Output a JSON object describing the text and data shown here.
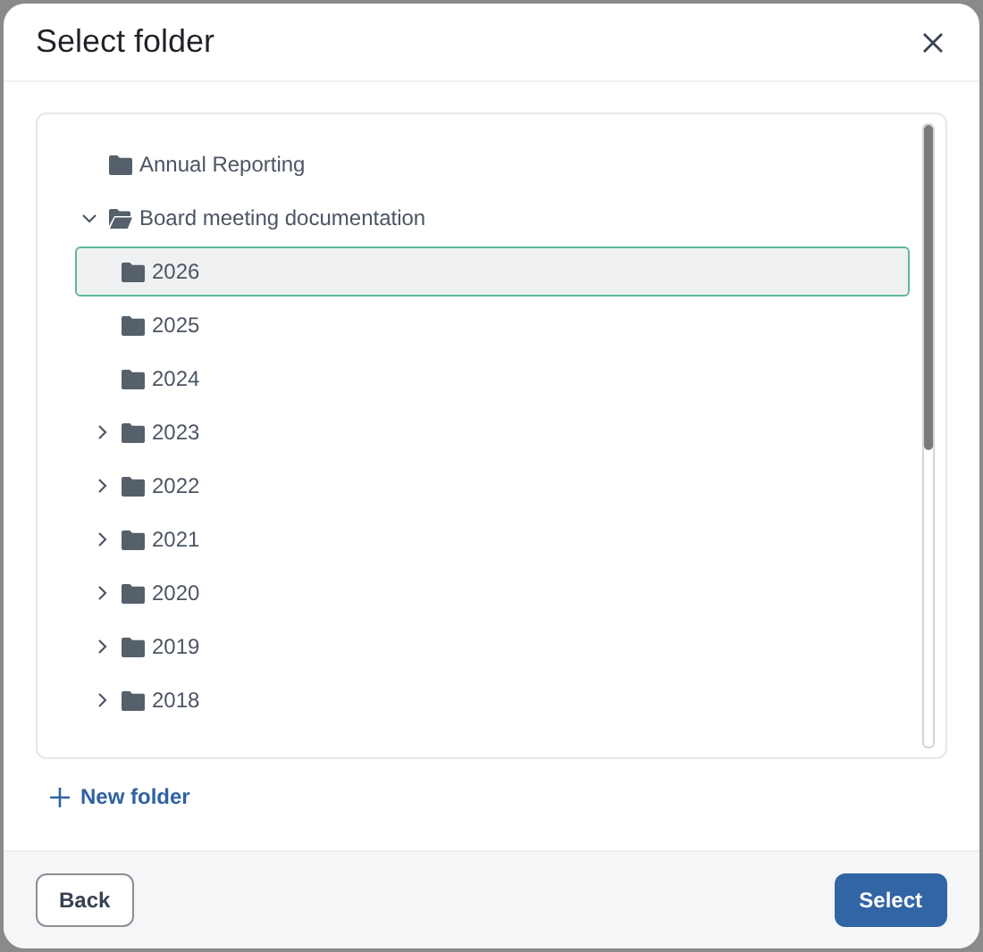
{
  "dialog": {
    "title": "Select folder"
  },
  "tree": [
    {
      "label": "Annual Reporting",
      "selected": false
    },
    {
      "label": "Board meeting documentation",
      "selected": false,
      "expanded": true,
      "children": [
        {
          "label": "2026",
          "selected": true
        },
        {
          "label": "2025",
          "selected": false
        },
        {
          "label": "2024",
          "selected": false
        },
        {
          "label": "2023",
          "selected": false,
          "expanded": false
        },
        {
          "label": "2022",
          "selected": false,
          "expanded": false
        },
        {
          "label": "2021",
          "selected": false,
          "expanded": false
        },
        {
          "label": "2020",
          "selected": false,
          "expanded": false
        },
        {
          "label": "2019",
          "selected": false,
          "expanded": false
        },
        {
          "label": "2018",
          "selected": false,
          "expanded": false
        }
      ]
    }
  ],
  "new_folder": "New folder",
  "buttons": {
    "back": "Back",
    "select": "Select"
  }
}
